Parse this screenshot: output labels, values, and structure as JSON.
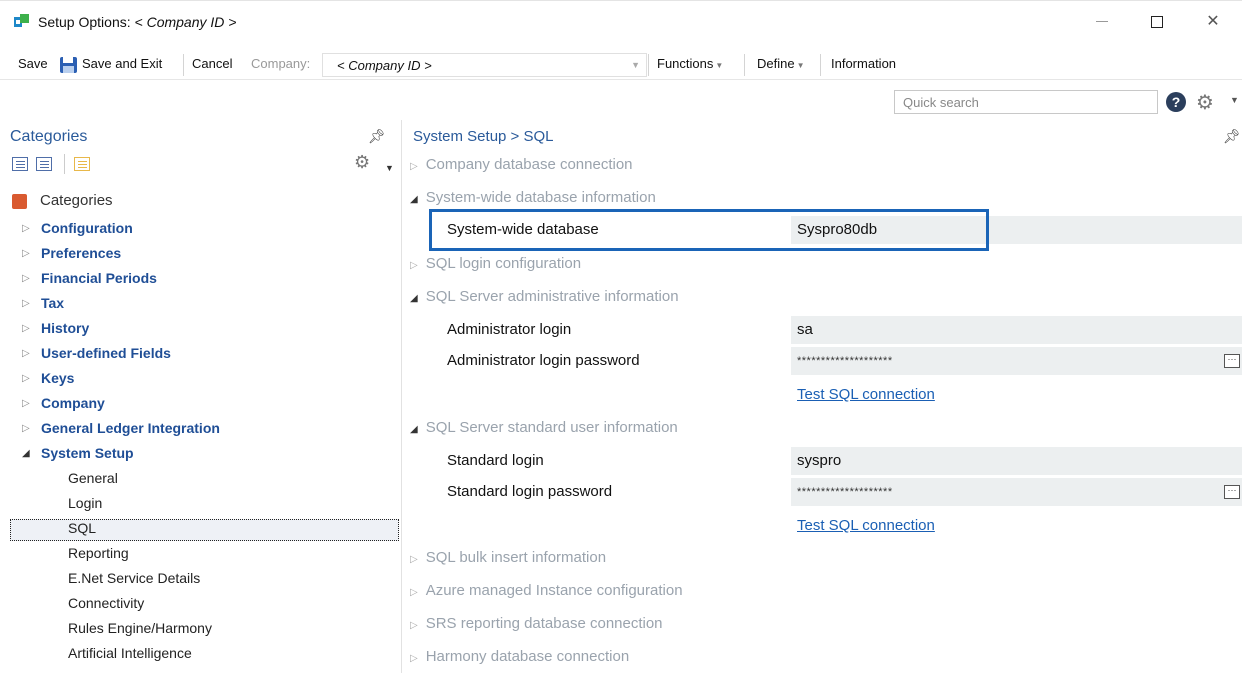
{
  "window": {
    "title_prefix": "Setup Options:",
    "title_company": "< Company ID >",
    "minimize": "—",
    "close": "✕"
  },
  "toolbar": {
    "save": "Save",
    "save_exit": "Save and Exit",
    "cancel": "Cancel",
    "company_label": "Company:",
    "company_value": "< Company ID >",
    "functions": "Functions",
    "define": "Define",
    "information": "Information"
  },
  "search": {
    "placeholder": "Quick search",
    "help": "?"
  },
  "left_panel": {
    "header": "Categories",
    "root": "Categories",
    "nodes": [
      {
        "label": "Configuration"
      },
      {
        "label": "Preferences"
      },
      {
        "label": "Financial Periods"
      },
      {
        "label": "Tax"
      },
      {
        "label": "History"
      },
      {
        "label": "User-defined Fields"
      },
      {
        "label": "Keys"
      },
      {
        "label": "Company"
      },
      {
        "label": "General Ledger Integration"
      },
      {
        "label": "System Setup"
      }
    ],
    "system_setup_children": [
      "General",
      "Login",
      "SQL",
      "Reporting",
      "E.Net Service Details",
      "Connectivity",
      "Rules Engine/Harmony",
      "Artificial Intelligence"
    ],
    "selected": "SQL"
  },
  "right_panel": {
    "breadcrumb": "System Setup > SQL",
    "sections": {
      "company_db": "Company database connection",
      "system_wide": "System-wide database information",
      "sql_login_config": "SQL login configuration",
      "sql_admin": "SQL Server administrative information",
      "sql_standard": "SQL Server standard user information",
      "bulk_insert": "SQL bulk insert information",
      "azure": "Azure managed Instance configuration",
      "srs": "SRS reporting database connection",
      "harmony": "Harmony database connection"
    },
    "fields": {
      "system_db_label": "System-wide database",
      "system_db_value": "Syspro80db",
      "admin_login_label": "Administrator login",
      "admin_login_value": "sa",
      "admin_pw_label": "Administrator login password",
      "admin_pw_value": "********************",
      "std_login_label": "Standard login",
      "std_login_value": "syspro",
      "std_pw_label": "Standard login password",
      "std_pw_value": "********************"
    },
    "test_link": "Test SQL connection"
  },
  "colors": {
    "accent": "#1a64b7",
    "tree_bold": "#1f4e96",
    "categories_icon": "#d95a30"
  },
  "icons": {
    "app": "syspro-app-icon",
    "save": "floppy-disk-icon",
    "help": "help-icon",
    "settings": "gear-icon",
    "pin": "pin-icon",
    "ellipsis": "ellipsis-icon"
  }
}
